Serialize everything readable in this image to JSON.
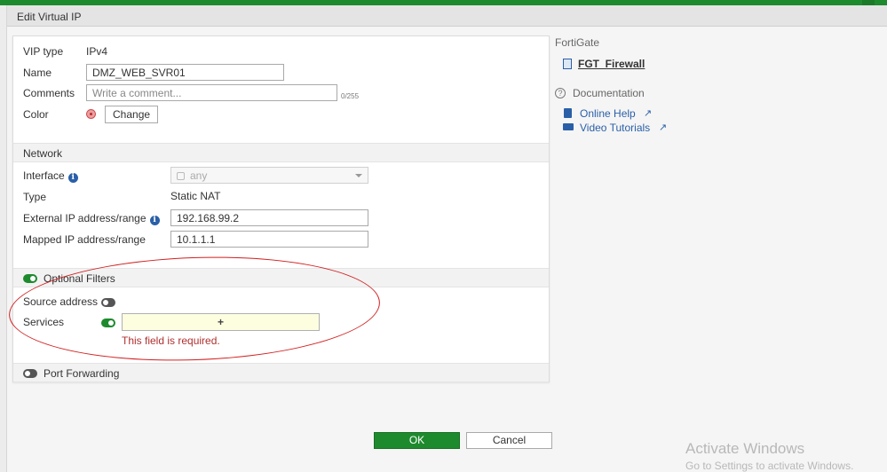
{
  "window": {
    "title": "Edit Virtual IP"
  },
  "form": {
    "vip_type": {
      "label": "VIP type",
      "value": "IPv4"
    },
    "name": {
      "label": "Name",
      "value": "DMZ_WEB_SVR01"
    },
    "comments": {
      "label": "Comments",
      "placeholder": "Write a comment...",
      "counter": "0/255"
    },
    "color": {
      "label": "Color",
      "button": "Change"
    }
  },
  "network": {
    "section_title": "Network",
    "interface": {
      "label": "Interface",
      "value": "any"
    },
    "type": {
      "label": "Type",
      "value": "Static NAT"
    },
    "external_ip": {
      "label": "External IP address/range",
      "value": "192.168.99.2"
    },
    "mapped_ip": {
      "label": "Mapped IP address/range",
      "value": "10.1.1.1"
    }
  },
  "optional_filters": {
    "section_title": "Optional Filters",
    "enabled": true,
    "source_address": {
      "label": "Source address",
      "enabled": false
    },
    "services": {
      "label": "Services",
      "enabled": true,
      "add_symbol": "+",
      "error": "This field is required."
    }
  },
  "port_forwarding": {
    "section_title": "Port Forwarding",
    "enabled": false
  },
  "sidebar": {
    "fortigate_heading": "FortiGate",
    "device_name": "FGT_Firewall",
    "documentation_heading": "Documentation",
    "links": [
      {
        "label": "Online Help"
      },
      {
        "label": "Video Tutorials"
      }
    ]
  },
  "footer": {
    "ok_label": "OK",
    "cancel_label": "Cancel"
  },
  "watermark": {
    "title": "Activate Windows",
    "subtitle": "Go to Settings to activate Windows."
  },
  "colors": {
    "accent_green": "#1e8a2e",
    "link_blue": "#2a5fa8",
    "error_red": "#b03030",
    "annotation_red": "#d21f1f"
  }
}
